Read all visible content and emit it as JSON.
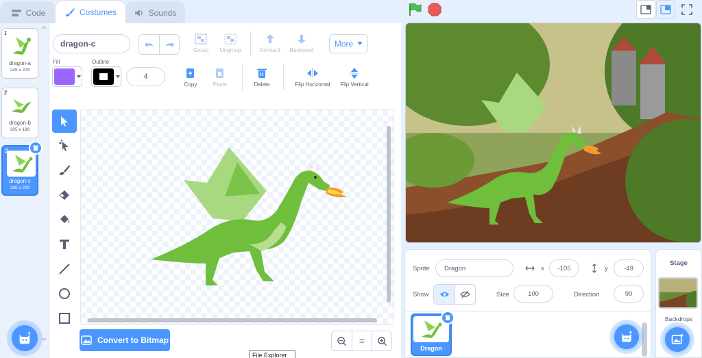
{
  "tabs": [
    {
      "label": "Code",
      "icon": "code-icon"
    },
    {
      "label": "Costumes",
      "icon": "brush-icon"
    },
    {
      "label": "Sounds",
      "icon": "speaker-icon"
    }
  ],
  "costumes": [
    {
      "number": "1",
      "name": "dragon-a",
      "size": "245 x 209"
    },
    {
      "number": "2",
      "name": "dragon-b",
      "size": "305 x 198"
    },
    {
      "number": "3",
      "name": "dragon-c",
      "size": "280 x 209"
    }
  ],
  "editor": {
    "costume_name": "dragon-c",
    "group": "Group",
    "ungroup": "Ungroup",
    "forward": "Forward",
    "backward": "Backward",
    "more": "More",
    "fill_label": "Fill",
    "outline_label": "Outline",
    "outline_width": "4",
    "copy": "Copy",
    "paste": "Paste",
    "delete": "Delete",
    "flip_h": "Flip Horizontal",
    "flip_v": "Flip Vertical",
    "fill_color": "#9966ff",
    "outline_color": "#000000",
    "convert": "Convert to Bitmap",
    "zoom_reset": "="
  },
  "tooltip": "File Explorer",
  "sprite": {
    "sprite_label": "Sprite",
    "name": "Dragon",
    "x_label": "x",
    "x": "-105",
    "y_label": "y",
    "y": "-49",
    "show_label": "Show",
    "size_label": "Size",
    "size": "100",
    "direction_label": "Direction",
    "direction": "90",
    "tile_name": "Dragon"
  },
  "stage_pane": {
    "title": "Stage",
    "backdrops": "Backdrops"
  },
  "colors": {
    "accent": "#4c97ff",
    "green_flag": "#4cbf56",
    "stop": "#ec5959"
  }
}
